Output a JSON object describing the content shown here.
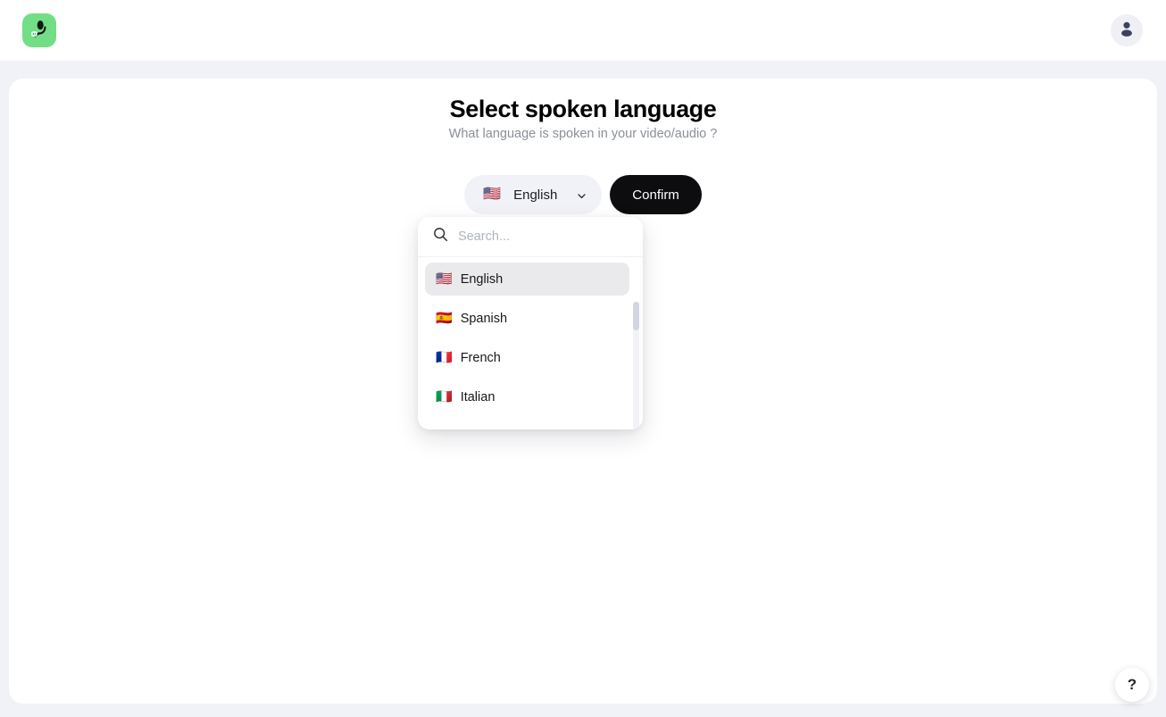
{
  "header": {
    "logo_icon": "microphone-icon",
    "avatar_icon": "user-avatar-icon"
  },
  "main": {
    "title": "Select spoken language",
    "subtitle": "What language is spoken in your video/audio ?",
    "selector": {
      "flag": "🇺🇸",
      "label": "English",
      "chevron_icon": "chevron-down-icon"
    },
    "confirm_label": "Confirm"
  },
  "dropdown": {
    "search": {
      "icon": "search-icon",
      "value": "",
      "placeholder": "Search..."
    },
    "options": [
      {
        "flag": "🇺🇸",
        "label": "English",
        "selected": true
      },
      {
        "flag": "🇪🇸",
        "label": "Spanish",
        "selected": false
      },
      {
        "flag": "🇫🇷",
        "label": "French",
        "selected": false
      },
      {
        "flag": "🇮🇹",
        "label": "Italian",
        "selected": false
      }
    ]
  },
  "help": {
    "label": "?",
    "icon": "question-mark-icon"
  },
  "colors": {
    "page_background": "#f1f2f7",
    "card_background": "#ffffff",
    "logo_green": "#72de86",
    "confirm_black": "#0d0d0f",
    "selected_row": "#eaeaec",
    "muted_text": "#8a8f98"
  }
}
